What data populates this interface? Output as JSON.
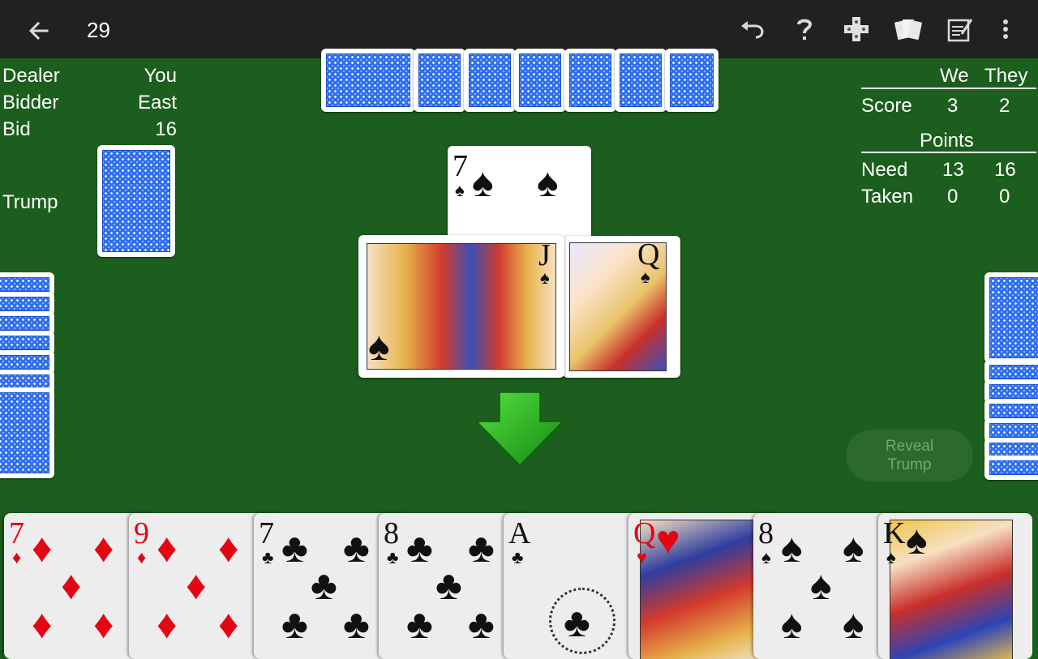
{
  "toolbar": {
    "title": "29",
    "icons": [
      "back-arrow-icon",
      "undo-icon",
      "help-icon",
      "dpad-icon",
      "cards-icon",
      "scorepad-icon",
      "more-vert-icon"
    ]
  },
  "info": {
    "dealer_label": "Dealer",
    "dealer_value": "You",
    "bidder_label": "Bidder",
    "bidder_value": "East",
    "bid_label": "Bid",
    "bid_value": "16",
    "trump_label": "Trump"
  },
  "scoreboard": {
    "col_we": "We",
    "col_they": "They",
    "score_label": "Score",
    "score_we": "3",
    "score_they": "2",
    "points_title": "Points",
    "need_label": "Need",
    "need_we": "13",
    "need_they": "16",
    "taken_label": "Taken",
    "taken_we": "0",
    "taken_they": "0"
  },
  "trick": {
    "north_card": {
      "rank": "7",
      "suit": "♠"
    },
    "west_card": {
      "rank": "J",
      "suit": "♠"
    },
    "east_card": {
      "rank": "Q",
      "suit": "♠"
    }
  },
  "reveal_button": {
    "line1": "Reveal",
    "line2": "Trump"
  },
  "hand": [
    {
      "rank": "7",
      "suit": "♦",
      "color": "#e30613"
    },
    {
      "rank": "9",
      "suit": "♦",
      "color": "#e30613"
    },
    {
      "rank": "7",
      "suit": "♣",
      "color": "#111111"
    },
    {
      "rank": "8",
      "suit": "♣",
      "color": "#111111"
    },
    {
      "rank": "A",
      "suit": "♣",
      "color": "#111111"
    },
    {
      "rank": "Q",
      "suit": "♥",
      "color": "#e30613"
    },
    {
      "rank": "8",
      "suit": "♠",
      "color": "#111111"
    },
    {
      "rank": "K",
      "suit": "♠",
      "color": "#111111"
    }
  ],
  "colors": {
    "table": "#1c5e1d",
    "toolbar": "#212121",
    "card_back": "#2f6ff0",
    "arrow": "#22b21d"
  }
}
